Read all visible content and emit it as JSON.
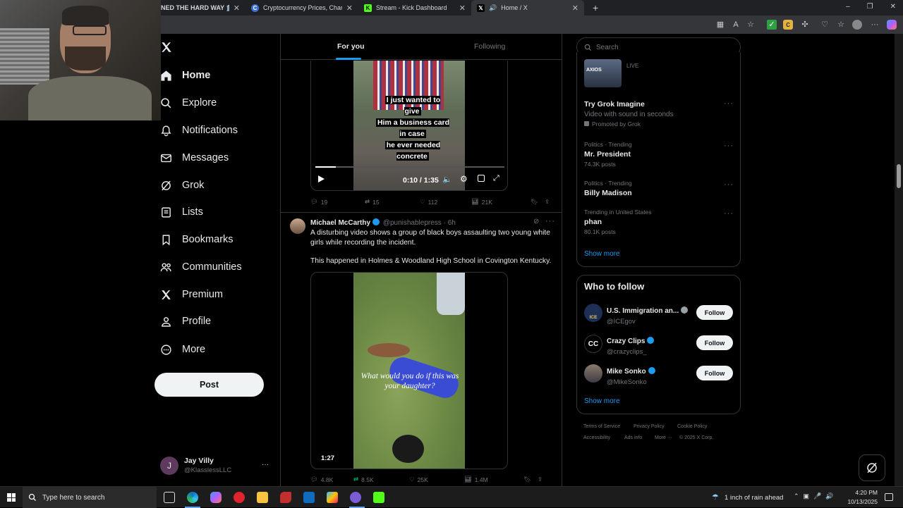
{
  "browser": {
    "tabs": [
      {
        "label": "NED THE HARD WAY 🏛️ | A",
        "active": false
      },
      {
        "label": "Cryptocurrency Prices, Charts, Da",
        "active": false
      },
      {
        "label": "Stream - Kick Dashboard",
        "active": false
      },
      {
        "label": "Home / X",
        "active": true
      }
    ],
    "new_tab": "+",
    "window_controls": [
      "–",
      "❐",
      "✕"
    ]
  },
  "nav": {
    "items": [
      {
        "label": "Home",
        "icon": "home-icon",
        "active": true
      },
      {
        "label": "Explore",
        "icon": "search-icon"
      },
      {
        "label": "Notifications",
        "icon": "bell-icon"
      },
      {
        "label": "Messages",
        "icon": "envelope-icon"
      },
      {
        "label": "Grok",
        "icon": "grok-icon"
      },
      {
        "label": "Lists",
        "icon": "list-icon"
      },
      {
        "label": "Bookmarks",
        "icon": "bookmark-icon"
      },
      {
        "label": "Communities",
        "icon": "people-icon"
      },
      {
        "label": "Premium",
        "icon": "x-logo-icon"
      },
      {
        "label": "Profile",
        "icon": "person-icon"
      },
      {
        "label": "More",
        "icon": "more-circle-icon"
      }
    ],
    "post_label": "Post",
    "account": {
      "initial": "J",
      "name": "Jay Villy",
      "handle": "@KlasslessLLC",
      "more": "···"
    }
  },
  "feed": {
    "tabs": {
      "for_you": "For you",
      "following": "Following"
    },
    "post1": {
      "caption_lines": [
        "I just wanted to give",
        "Him a business card in case",
        "he ever needed concrete"
      ],
      "video_time": "0:10 / 1:35",
      "video_progress": 0.11,
      "replies": "19",
      "reposts": "15",
      "likes": "112",
      "views": "21K"
    },
    "post2": {
      "author": "Michael McCarthy",
      "handle": "@punishablepress",
      "sep": "·",
      "time": "6h",
      "text1": "A disturbing video shows a group of black boys assaulting two young white girls while recording the incident.",
      "text2": "This happened in Holmes & Woodland High School in Covington Kentucky.",
      "video_overlay": "What would you do if this was your daughter?",
      "duration": "1:27",
      "replies": "4.8K",
      "reposts": "8.5K",
      "likes": "25K",
      "views": "1.4M"
    }
  },
  "sidebar": {
    "search_placeholder": "Search",
    "live_label": "LIVE",
    "live_thumb_text": "AXIOS",
    "promo": {
      "title": "Try Grok Imagine",
      "subtitle": "Video with sound in seconds",
      "promoted": "Promoted by Grok"
    },
    "trends": [
      {
        "meta": "Politics · Trending",
        "name": "Mr. President",
        "count": "74.3K posts"
      },
      {
        "meta": "Politics · Trending",
        "name": "Billy Madison",
        "count": ""
      },
      {
        "meta": "Trending in United States",
        "name": "phan",
        "count": "80.1K posts"
      }
    ],
    "show_more": "Show more",
    "who_to_follow": {
      "title": "Who to follow",
      "accounts": [
        {
          "name": "U.S. Immigration an...",
          "handle": "@ICEgov",
          "button": "Follow",
          "avatar": "ICE"
        },
        {
          "name": "Crazy Clips",
          "handle": "@crazyclips_",
          "button": "Follow",
          "avatar": "CC"
        },
        {
          "name": "Mike Sonko",
          "handle": "@MikeSonko",
          "button": "Follow",
          "avatar": ""
        }
      ],
      "show_more": "Show more"
    },
    "footer": [
      "Terms of Service",
      "Privacy Policy",
      "Cookie Policy",
      "Accessibility",
      "Ads info",
      "More ···",
      "© 2025 X Corp."
    ]
  },
  "taskbar": {
    "search_placeholder": "Type here to search",
    "weather": "1 inch of rain ahead",
    "time": "4:20 PM",
    "date": "10/13/2025"
  },
  "colors": {
    "accent": "#1d9bf0",
    "bg": "#000000",
    "muted": "#71767b",
    "border": "#2f3336"
  }
}
